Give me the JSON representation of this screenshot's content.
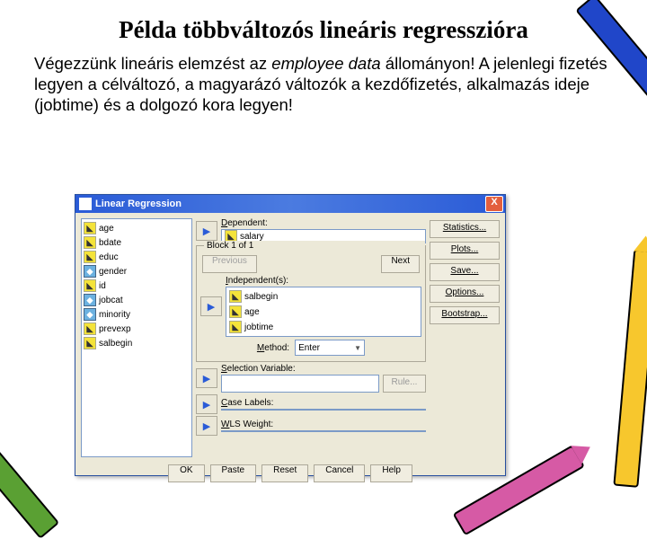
{
  "slide": {
    "title": "Példa többváltozós lineáris regresszióra",
    "body_pre": "Végezzünk lineáris elemzést az ",
    "body_em": "employee data",
    "body_post": " állományon! A jelenlegi fizetés legyen a célváltozó, a magyarázó változók a kezdőfizetés, alkalmazás ideje (jobtime) és a dolgozó kora legyen!"
  },
  "dialog": {
    "title": "Linear Regression",
    "close": "X",
    "variables": [
      {
        "icon": "scale",
        "name": "age"
      },
      {
        "icon": "scale",
        "name": "bdate"
      },
      {
        "icon": "scale",
        "name": "educ"
      },
      {
        "icon": "nom",
        "name": "gender"
      },
      {
        "icon": "scale",
        "name": "id"
      },
      {
        "icon": "nom",
        "name": "jobcat"
      },
      {
        "icon": "nom",
        "name": "minority"
      },
      {
        "icon": "scale",
        "name": "prevexp"
      },
      {
        "icon": "scale",
        "name": "salbegin"
      }
    ],
    "dependent_label": "Dependent:",
    "dependent": {
      "icon": "scale",
      "name": "salary"
    },
    "block_label": "Block 1 of 1",
    "prev": "Previous",
    "next": "Next",
    "independents_label": "Independent(s):",
    "independents": [
      {
        "icon": "scale",
        "name": "salbegin"
      },
      {
        "icon": "scale",
        "name": "age"
      },
      {
        "icon": "scale",
        "name": "jobtime"
      }
    ],
    "method_label": "Method:",
    "method_value": "Enter",
    "selection_label": "Selection Variable:",
    "rule": "Rule...",
    "case_label": "Case Labels:",
    "wls_label": "WLS Weight:",
    "side_buttons": [
      "Statistics...",
      "Plots...",
      "Save...",
      "Options...",
      "Bootstrap..."
    ],
    "bottom_buttons": [
      "OK",
      "Paste",
      "Reset",
      "Cancel",
      "Help"
    ]
  }
}
